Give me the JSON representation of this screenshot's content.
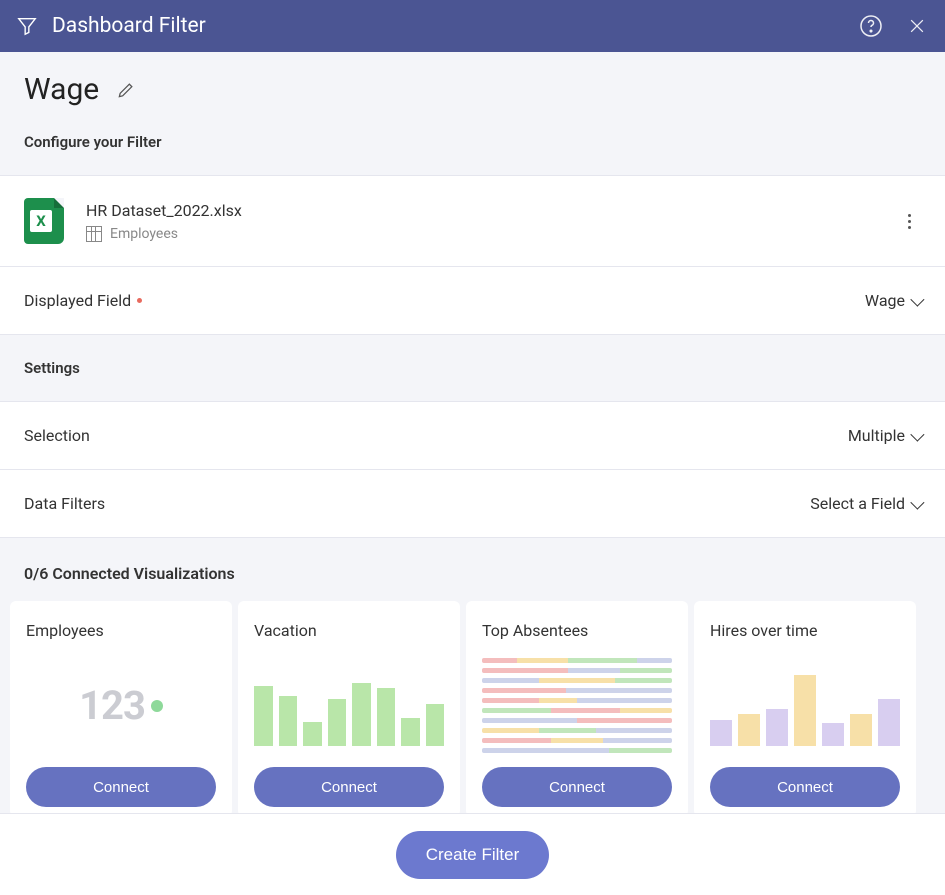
{
  "titlebar": {
    "title": "Dashboard Filter"
  },
  "filter": {
    "name": "Wage"
  },
  "sections": {
    "configure": "Configure your Filter",
    "settings": "Settings"
  },
  "dataset": {
    "filename": "HR Dataset_2022.xlsx",
    "sheet": "Employees"
  },
  "fields": {
    "displayed_field": {
      "label": "Displayed Field",
      "value": "Wage",
      "required": true
    },
    "selection": {
      "label": "Selection",
      "value": "Multiple"
    },
    "data_filters": {
      "label": "Data Filters",
      "value": "Select a Field"
    }
  },
  "visualizations": {
    "count_label": "0/6 Connected Visualizations",
    "connect_label": "Connect",
    "cards": [
      {
        "title": "Employees"
      },
      {
        "title": "Vacation"
      },
      {
        "title": "Top Absentees"
      },
      {
        "title": "Hires over time"
      }
    ]
  },
  "footer": {
    "create_button": "Create Filter"
  }
}
